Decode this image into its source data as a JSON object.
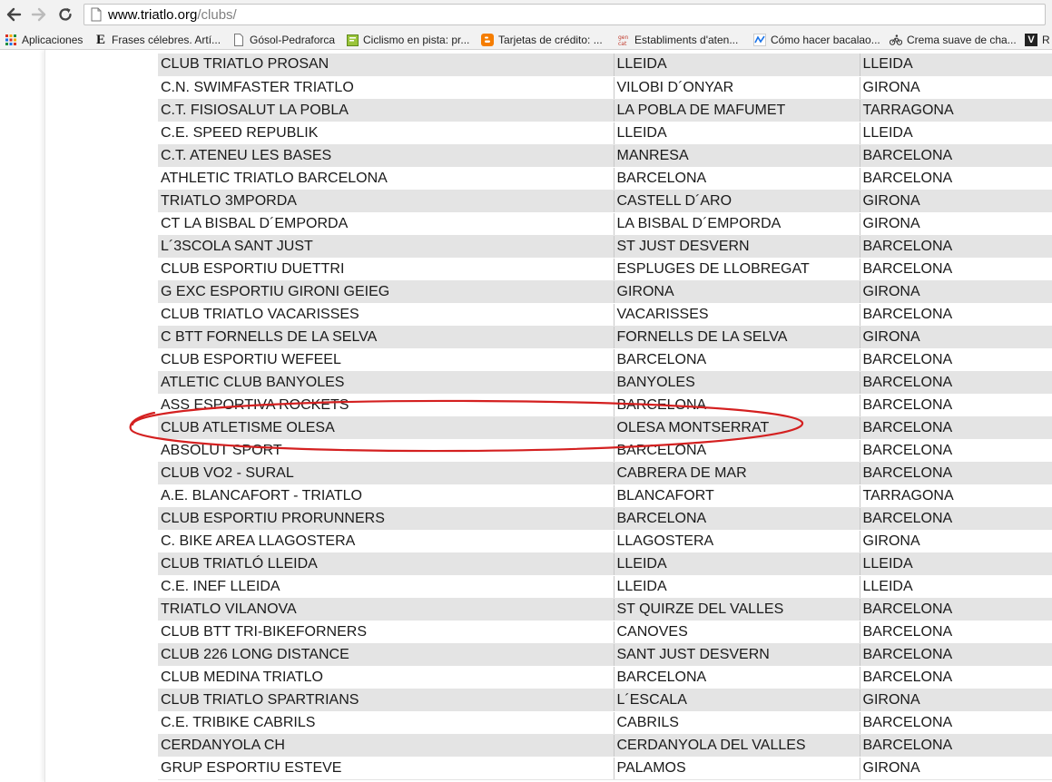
{
  "browser": {
    "url_host": "www.triatlo.org",
    "url_path": "/clubs/",
    "bookmarks": [
      {
        "label": "Aplicaciones",
        "icon": "apps-grid-icon"
      },
      {
        "label": "Frases célebres. Artí...",
        "icon": "e-letter-icon"
      },
      {
        "label": "Gósol-Pedraforca",
        "icon": "page-icon"
      },
      {
        "label": "Ciclismo en pista: pr...",
        "icon": "green-note-icon"
      },
      {
        "label": "Tarjetas de crédito: ...",
        "icon": "blogger-icon"
      },
      {
        "label": "Establiments d'aten...",
        "icon": "gencat-icon"
      },
      {
        "label": "Cómo hacer bacalao...",
        "icon": "wave-icon"
      },
      {
        "label": "Crema suave de cha...",
        "icon": "cyclist-icon"
      },
      {
        "label": "R",
        "icon": "v-letter-icon"
      }
    ]
  },
  "colors": {
    "row_shade": "#e4e4e4",
    "ellipse": "#d42020"
  },
  "clubs": [
    [
      "CLUB TRIATLO PROSAN",
      "LLEIDA",
      "LLEIDA"
    ],
    [
      "C.N. SWIMFASTER TRIATLO",
      "VILOBI D´ONYAR",
      "GIRONA"
    ],
    [
      "C.T. FISIOSALUT LA POBLA",
      "LA POBLA DE MAFUMET",
      "TARRAGONA"
    ],
    [
      "C.E. SPEED REPUBLIK",
      "LLEIDA",
      "LLEIDA"
    ],
    [
      "C.T. ATENEU LES BASES",
      "MANRESA",
      "BARCELONA"
    ],
    [
      "ATHLETIC TRIATLO BARCELONA",
      "BARCELONA",
      "BARCELONA"
    ],
    [
      "TRIATLO 3MPORDA",
      "CASTELL D´ARO",
      "GIRONA"
    ],
    [
      "CT LA BISBAL D´EMPORDA",
      "LA BISBAL D´EMPORDA",
      "GIRONA"
    ],
    [
      "L´3SCOLA SANT JUST",
      "ST JUST DESVERN",
      "BARCELONA"
    ],
    [
      "CLUB ESPORTIU DUETTRI",
      "ESPLUGES DE LLOBREGAT",
      "BARCELONA"
    ],
    [
      "G EXC ESPORTIU GIRONI GEIEG",
      "GIRONA",
      "GIRONA"
    ],
    [
      "CLUB TRIATLO VACARISSES",
      "VACARISSES",
      "BARCELONA"
    ],
    [
      "C BTT FORNELLS DE LA SELVA",
      "FORNELLS DE LA SELVA",
      "GIRONA"
    ],
    [
      "CLUB ESPORTIU WEFEEL",
      "BARCELONA",
      "BARCELONA"
    ],
    [
      "ATLETIC CLUB BANYOLES",
      "BANYOLES",
      "BARCELONA"
    ],
    [
      "ASS ESPORTIVA ROCKETS",
      "BARCELONA",
      "BARCELONA"
    ],
    [
      "CLUB ATLETISME OLESA",
      "OLESA MONTSERRAT",
      "BARCELONA"
    ],
    [
      "ABSOLUT SPORT",
      "BARCELONA",
      "BARCELONA"
    ],
    [
      "CLUB VO2 - SURAL",
      "CABRERA DE MAR",
      "BARCELONA"
    ],
    [
      "A.E. BLANCAFORT - TRIATLO",
      "BLANCAFORT",
      "TARRAGONA"
    ],
    [
      "CLUB ESPORTIU PRORUNNERS",
      "BARCELONA",
      "BARCELONA"
    ],
    [
      "C. BIKE AREA LLAGOSTERA",
      "LLAGOSTERA",
      "GIRONA"
    ],
    [
      "CLUB TRIATLÓ LLEIDA",
      "LLEIDA",
      "LLEIDA"
    ],
    [
      "C.E. INEF LLEIDA",
      "LLEIDA",
      "LLEIDA"
    ],
    [
      "TRIATLO VILANOVA",
      "ST QUIRZE DEL VALLES",
      "BARCELONA"
    ],
    [
      "CLUB  BTT TRI-BIKEFORNERS",
      "CANOVES",
      "BARCELONA"
    ],
    [
      "CLUB 226 LONG DISTANCE",
      "SANT JUST DESVERN",
      "BARCELONA"
    ],
    [
      "CLUB MEDINA TRIATLO",
      "BARCELONA",
      "BARCELONA"
    ],
    [
      "CLUB TRIATLO SPARTRIANS",
      "L´ESCALA",
      "GIRONA"
    ],
    [
      "C.E. TRIBIKE CABRILS",
      "CABRILS",
      "BARCELONA"
    ],
    [
      "CERDANYOLA CH",
      "CERDANYOLA DEL VALLES",
      "BARCELONA"
    ],
    [
      "GRUP ESPORTIU ESTEVE",
      "PALAMOS",
      "GIRONA"
    ]
  ]
}
